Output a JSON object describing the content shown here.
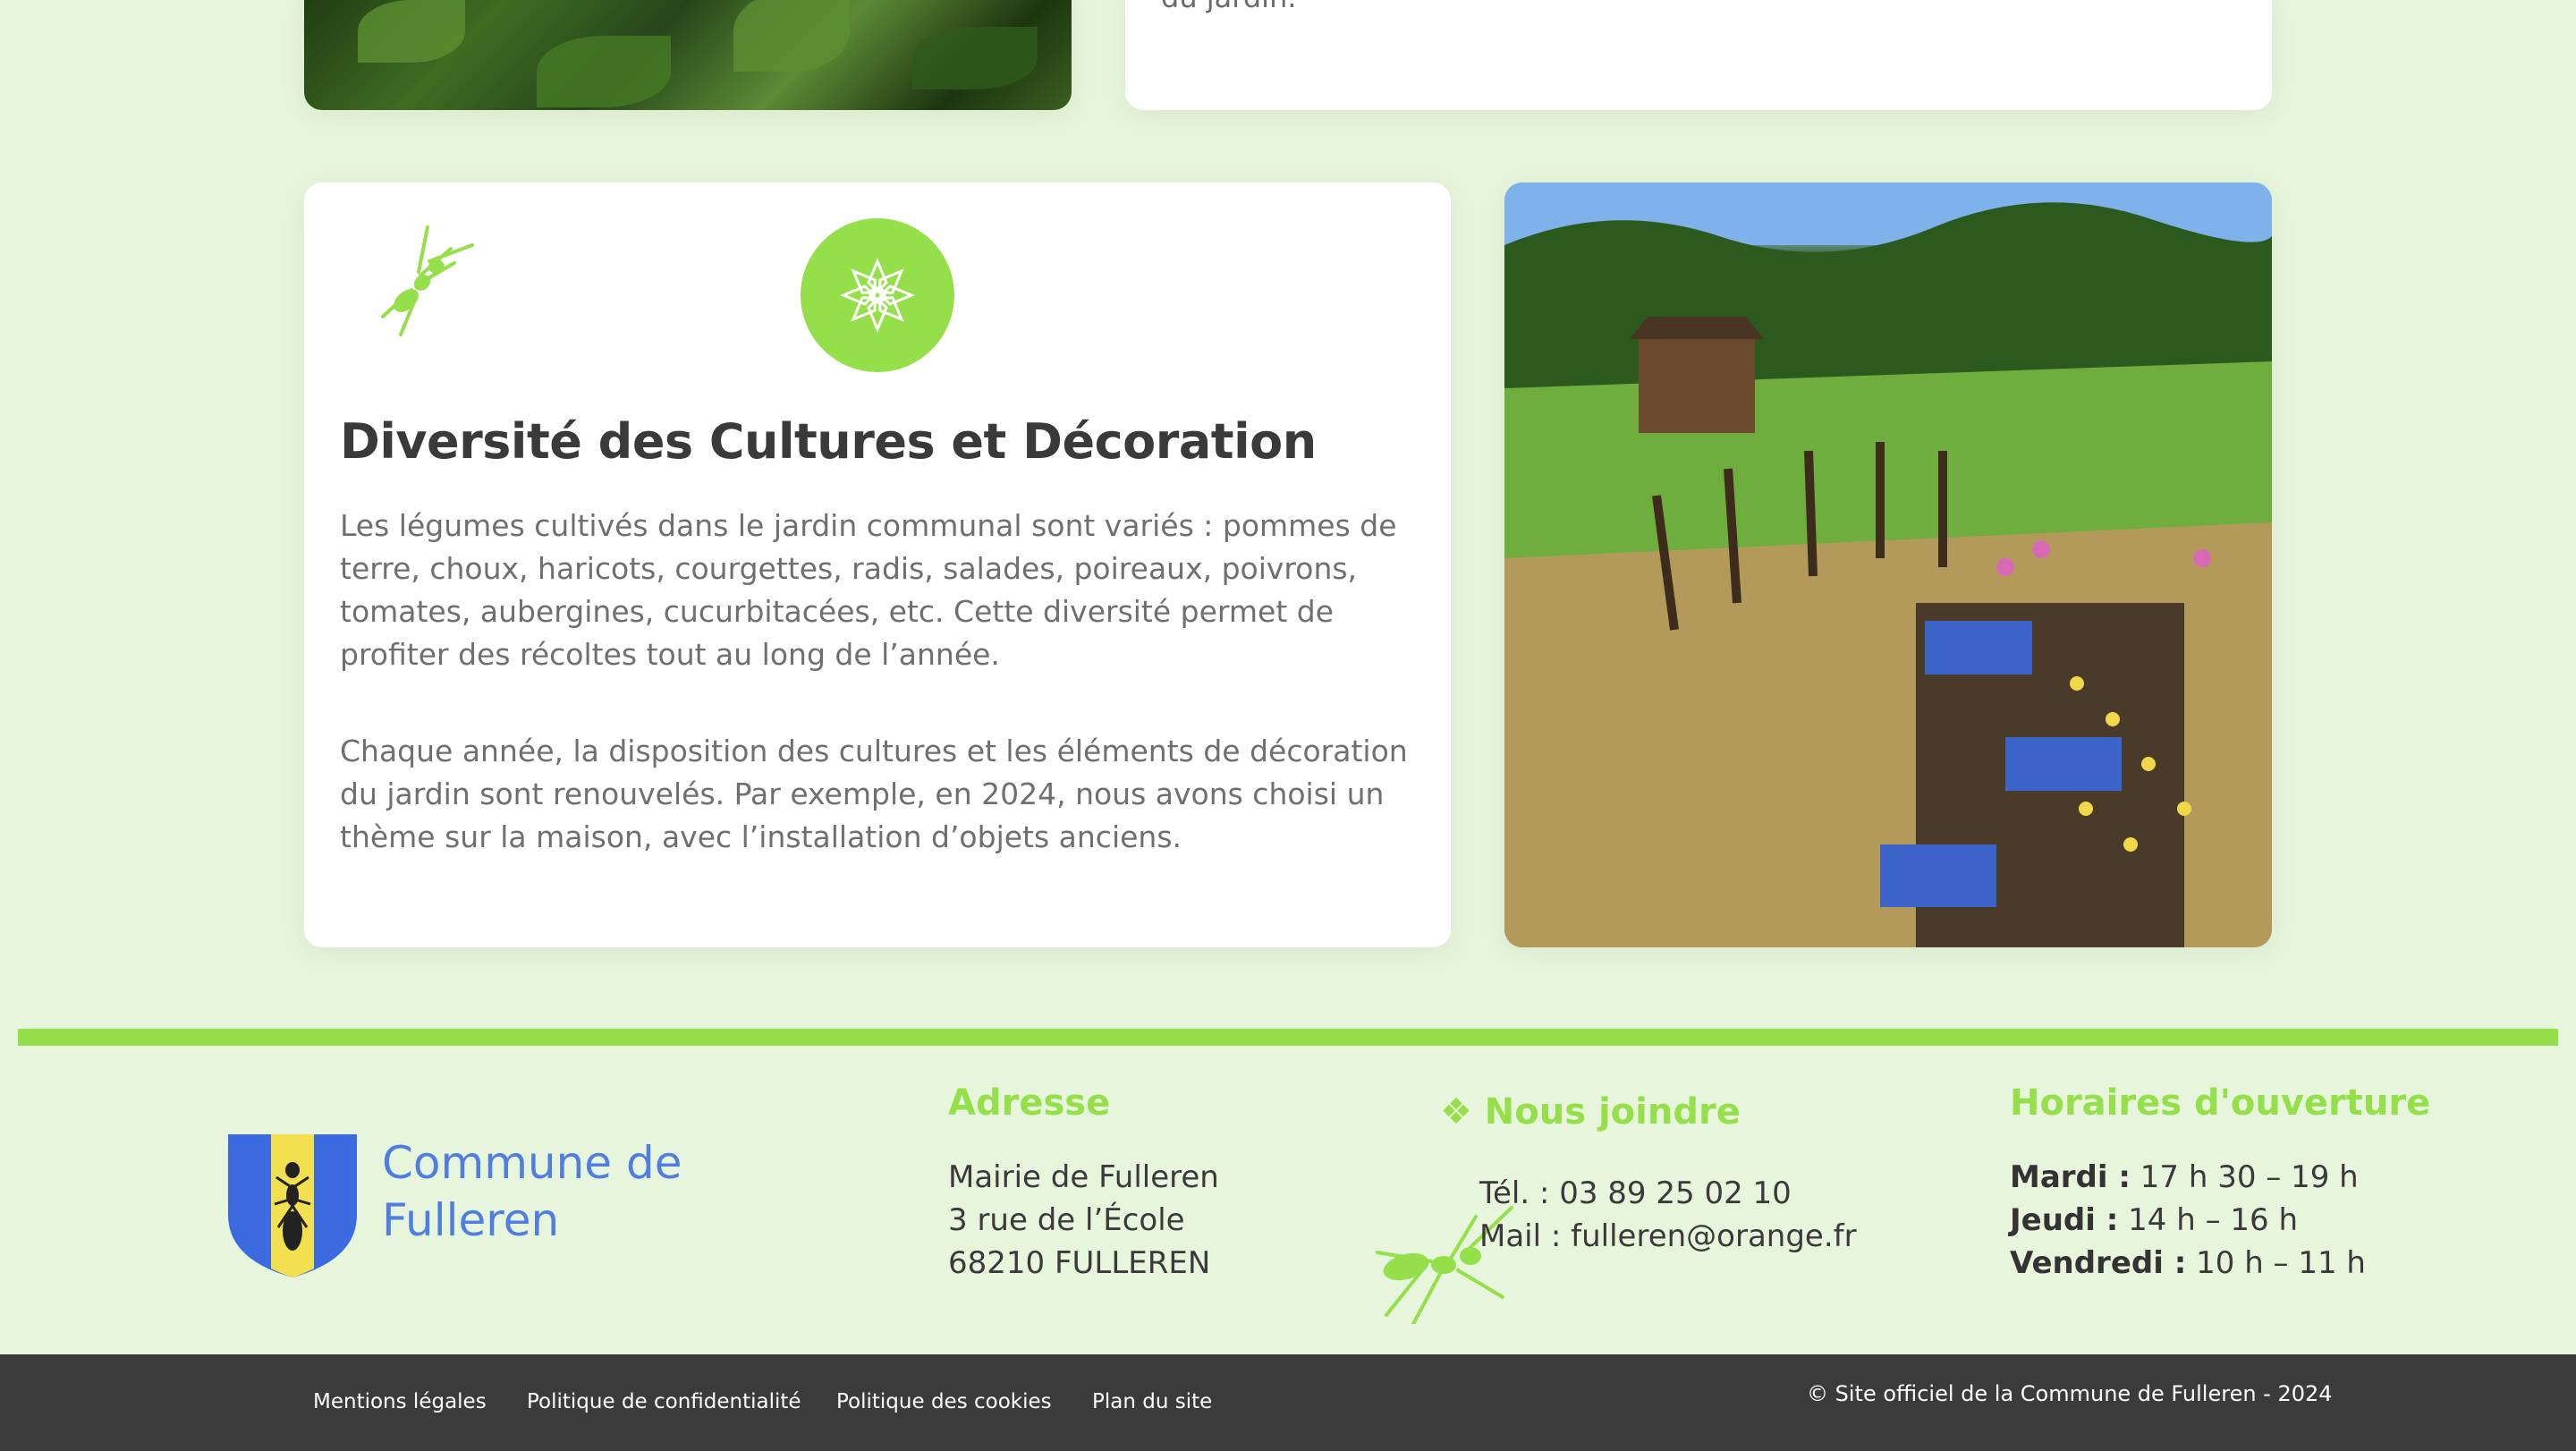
{
  "top_card": {
    "text_tail": "du jardin."
  },
  "feature": {
    "title": "Diversité des Cultures et Décoration",
    "paragraph_1": "Les légumes cultivés dans le jardin communal sont variés : pommes de terre, choux, haricots, courgettes, radis, salades, poireaux, poivrons, tomates, aubergines, cucurbitacées, etc. Cette diversité permet de profiter des récoltes tout au long de l’année.",
    "paragraph_2": "Chaque année, la disposition des cultures et les éléments de décoration du jardin sont renouvelés. Par exemple, en 2024, nous avons choisi un thème sur la maison, avec l’installation d’objets anciens.",
    "badge_icon": "flower-icon",
    "decor_icon": "ant-icon"
  },
  "footer": {
    "logo_line_1": "Commune de",
    "logo_line_2": "Fulleren",
    "address": {
      "title": "Adresse",
      "line_1": "Mairie de Fulleren",
      "line_2": "3 rue de l’École",
      "line_3": "68210 FULLEREN"
    },
    "contact": {
      "title": "❖ Nous joindre",
      "phone": "Tél. : 03 89 25 02 10",
      "mail": "Mail : fulleren@orange.fr"
    },
    "hours": {
      "title": "Horaires d'ouverture",
      "rows": [
        {
          "day": "Mardi :",
          "time": "17 h 30 – 19 h"
        },
        {
          "day": "Jeudi :",
          "time": "14 h – 16 h"
        },
        {
          "day": "Vendredi :",
          "time": "10 h – 11 h"
        }
      ]
    }
  },
  "bottom_bar": {
    "links": [
      "Mentions légales",
      "Politique de confidentialité",
      "Politique des cookies",
      "Plan du site"
    ],
    "copyright": "© Site officiel de la Commune de Fulleren - 2024"
  },
  "colors": {
    "accent_green": "#95e04a",
    "page_background": "#e8f5dd",
    "logo_blue": "#4f7ee0",
    "bottom_bar": "#3b3b3b"
  }
}
